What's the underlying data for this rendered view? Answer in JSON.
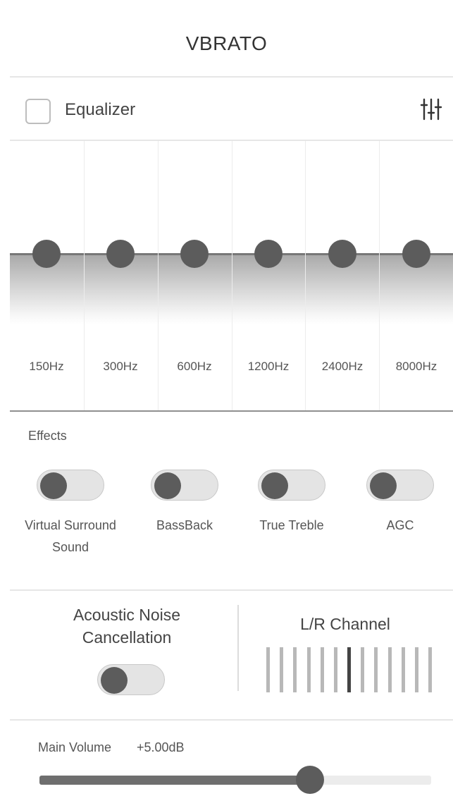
{
  "header": {
    "title": "VBRATO"
  },
  "equalizer": {
    "label": "Equalizer",
    "enabled": false,
    "settings_icon": "sliders-icon",
    "bands": [
      {
        "freq": "150Hz",
        "level": 0
      },
      {
        "freq": "300Hz",
        "level": 0
      },
      {
        "freq": "600Hz",
        "level": 0
      },
      {
        "freq": "1200Hz",
        "level": 0
      },
      {
        "freq": "2400Hz",
        "level": 0
      },
      {
        "freq": "8000Hz",
        "level": 0
      }
    ]
  },
  "effects": {
    "label": "Effects",
    "items": [
      {
        "label": "Virtual Surround\nSound",
        "on": false
      },
      {
        "label": "BassBack",
        "on": false
      },
      {
        "label": "True Treble",
        "on": false
      },
      {
        "label": "AGC",
        "on": false
      }
    ]
  },
  "anc": {
    "title": "Acoustic Noise\nCancellation",
    "on": false
  },
  "lr_channel": {
    "title": "L/R Channel",
    "balance": 0,
    "bar_count": 13,
    "active_index": 6
  },
  "volume": {
    "label": "Main Volume",
    "value_text": "+5.00dB",
    "fraction": 0.69
  },
  "colors": {
    "knob": "#5c5c5c",
    "track_fill": "#6e6e6e",
    "divider": "#e6e6e6"
  }
}
